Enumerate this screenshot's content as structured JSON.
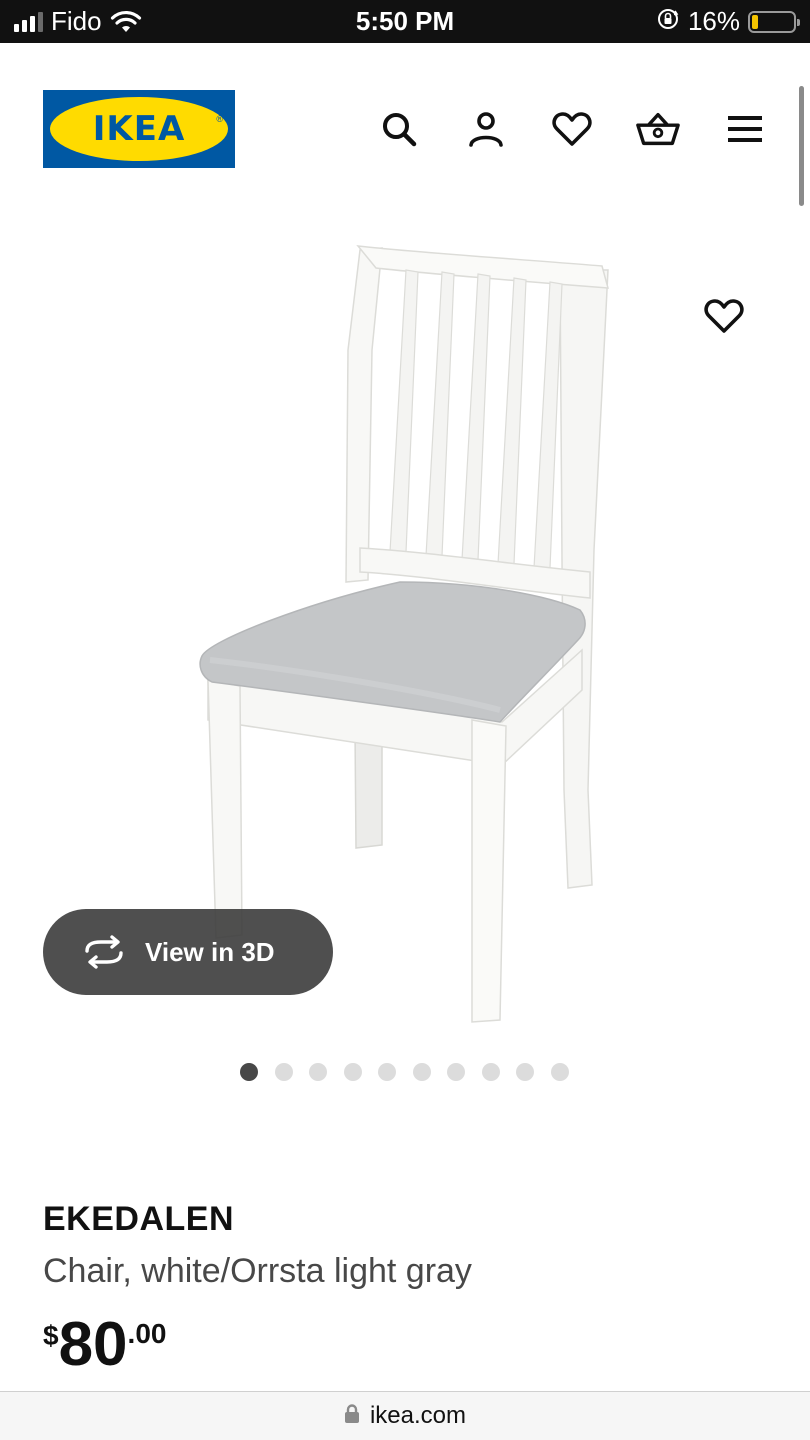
{
  "status_bar": {
    "carrier": "Fido",
    "time": "5:50 PM",
    "battery_percent": "16%",
    "battery_level": 0.16,
    "icons": [
      "signal-icon",
      "wifi-icon",
      "orientation-lock-icon",
      "battery-icon"
    ]
  },
  "header": {
    "logo_text": "IKEA",
    "logo_registered": "®",
    "icons": [
      "search-icon",
      "user-icon",
      "heart-icon",
      "basket-icon",
      "menu-icon"
    ]
  },
  "product": {
    "image_alt": "white chair with gray seat cushion",
    "view3d_label": "View in 3D",
    "carousel": {
      "total": 10,
      "active": 1
    },
    "name": "EKEDALEN",
    "description": "Chair, white/Orrsta light gray",
    "price": {
      "currency": "$",
      "integer": "80",
      "decimal": ".00"
    }
  },
  "browser": {
    "url": "ikea.com"
  },
  "colors": {
    "ikea_blue": "#0058a3",
    "ikea_yellow": "#ffdb00",
    "status_bar_bg": "#111111",
    "battery_low": "#f5c400",
    "view3d_bg": "#3c3c3c"
  }
}
